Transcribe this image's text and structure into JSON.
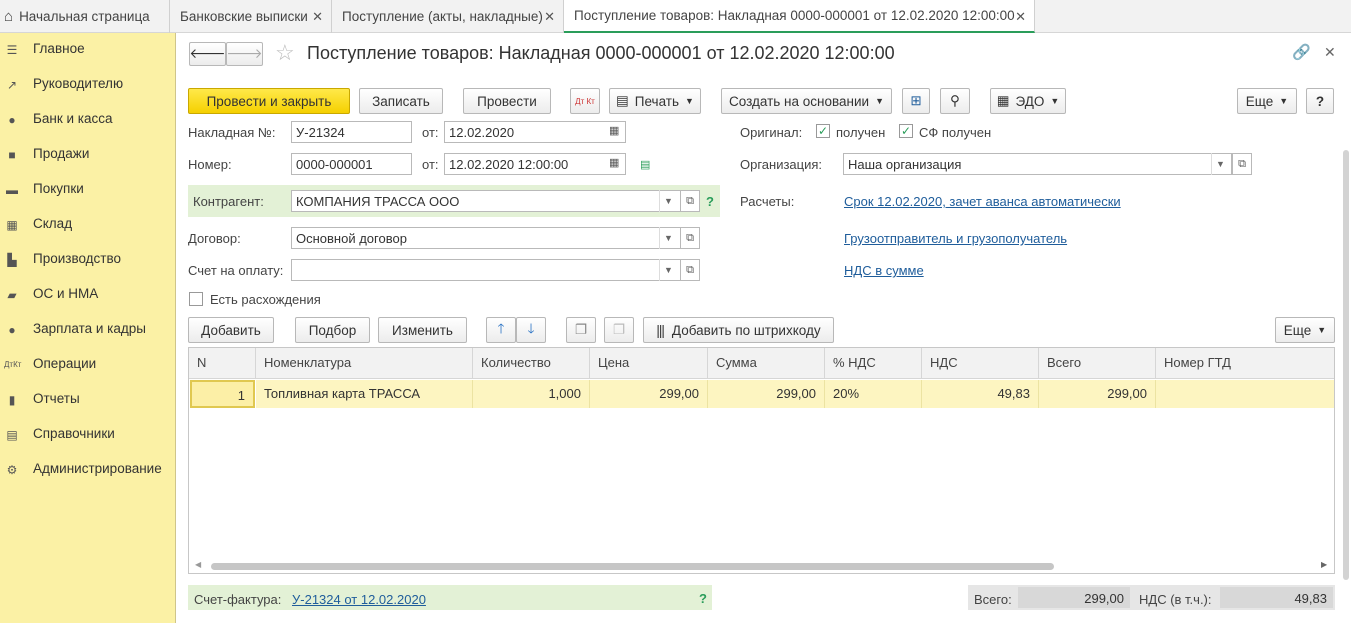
{
  "tabs": [
    {
      "label": "Начальная страница"
    },
    {
      "label": "Банковские выписки"
    },
    {
      "label": "Поступление (акты, накладные)"
    },
    {
      "label": "Поступление товаров: Накладная 0000-000001 от 12.02.2020 12:00:00"
    }
  ],
  "sidebar": {
    "items": [
      {
        "label": "Главное",
        "icon": "menu-icon"
      },
      {
        "label": "Руководителю",
        "icon": "trend-icon"
      },
      {
        "label": "Банк и касса",
        "icon": "coin-icon"
      },
      {
        "label": "Продажи",
        "icon": "bag-icon"
      },
      {
        "label": "Покупки",
        "icon": "cart-icon"
      },
      {
        "label": "Склад",
        "icon": "warehouse-icon"
      },
      {
        "label": "Производство",
        "icon": "factory-icon"
      },
      {
        "label": "ОС и НМА",
        "icon": "truck-icon"
      },
      {
        "label": "Зарплата и кадры",
        "icon": "person-icon"
      },
      {
        "label": "Операции",
        "icon": "dt-kt-icon"
      },
      {
        "label": "Отчеты",
        "icon": "bar-chart-icon"
      },
      {
        "label": "Справочники",
        "icon": "books-icon"
      },
      {
        "label": "Администрирование",
        "icon": "gear-icon"
      }
    ]
  },
  "doc": {
    "title": "Поступление товаров: Накладная 0000-000001 от 12.02.2020 12:00:00"
  },
  "toolbar": {
    "post_close": "Провести и закрыть",
    "save": "Записать",
    "post": "Провести",
    "dtkt": "Дт Кт",
    "print": "Печать",
    "create_based": "Создать на основании",
    "edo": "ЭДО",
    "more": "Еще",
    "help": "?"
  },
  "form": {
    "invoice_label": "Накладная №:",
    "invoice_value": "У-21324",
    "from_label": "от:",
    "invoice_date": "12.02.2020",
    "number_label": "Номер:",
    "number_value": "0000-000001",
    "number_date": "12.02.2020 12:00:00",
    "counterparty_label": "Контрагент:",
    "counterparty_value": "КОМПАНИЯ ТРАССА ООО",
    "counterparty_help": "?",
    "contract_label": "Договор:",
    "contract_value": "Основной договор",
    "payment_label": "Счет на оплату:",
    "payment_value": "",
    "discrepancy_label": "Есть расхождения",
    "original_label": "Оригинал:",
    "received_label": "получен",
    "sf_received_label": "СФ получен",
    "org_label": "Организация:",
    "org_value": "Наша организация",
    "settlements_label": "Расчеты:",
    "settlements_link": "Срок 12.02.2020, зачет аванса автоматически",
    "shipper_link": "Грузоотправитель и грузополучатель",
    "vat_link": "НДС в сумме"
  },
  "table_toolbar": {
    "add": "Добавить",
    "select": "Подбор",
    "edit": "Изменить",
    "barcode": "Добавить по штрихкоду",
    "more": "Еще"
  },
  "table": {
    "headers": [
      "N",
      "Номенклатура",
      "Количество",
      "Цена",
      "Сумма",
      "% НДС",
      "НДС",
      "Всего",
      "Номер ГТД"
    ],
    "rows": [
      [
        "1",
        "Топливная карта ТРАССА",
        "1,000",
        "299,00",
        "299,00",
        "20%",
        "49,83",
        "299,00",
        ""
      ]
    ]
  },
  "footer": {
    "invoice_label": "Счет-фактура:",
    "invoice_link": "У-21324 от 12.02.2020",
    "help": "?",
    "total_label": "Всего:",
    "total_value": "299,00",
    "vat_label": "НДС (в т.ч.):",
    "vat_value": "49,83"
  },
  "colors": {
    "accent": "#2a9d5a",
    "primary_button": "#f5d000",
    "sidebar": "#fbf1a5",
    "link": "#1f5d9b"
  }
}
